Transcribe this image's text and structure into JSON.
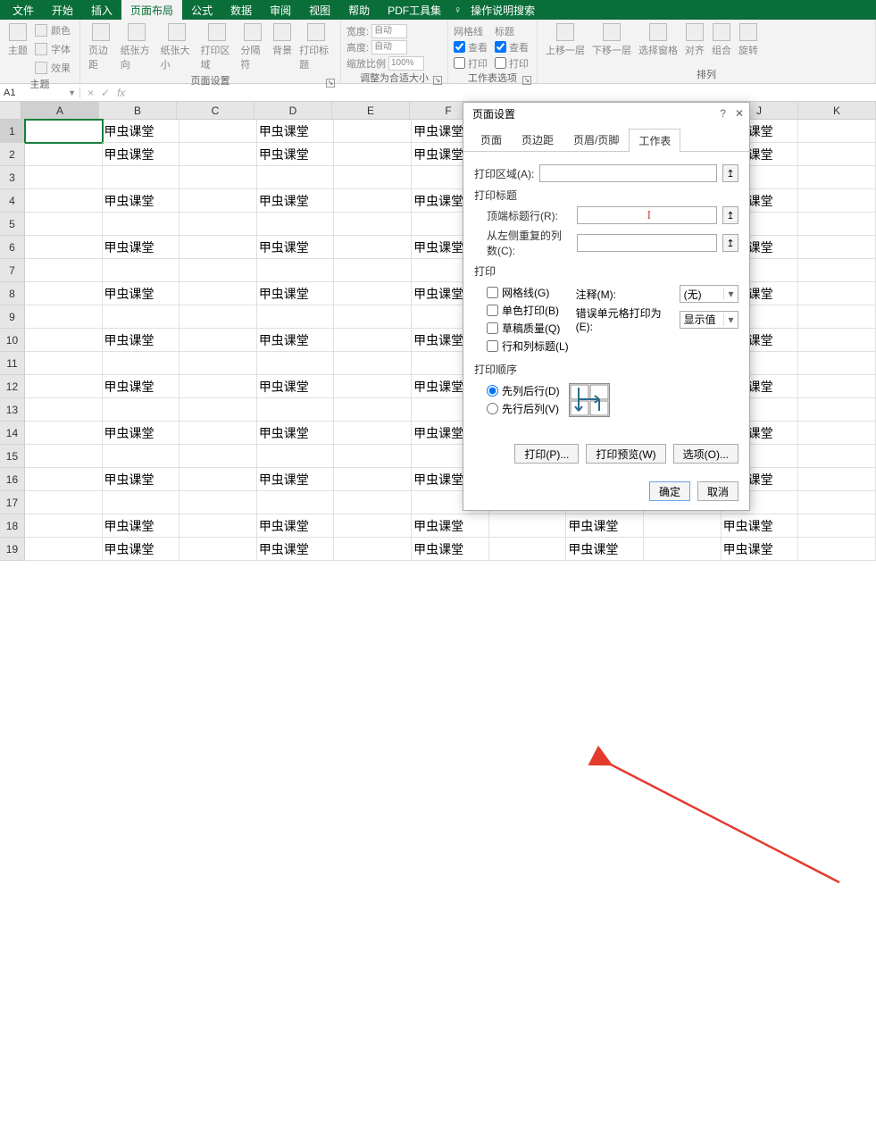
{
  "menubar": {
    "items": [
      "文件",
      "开始",
      "插入",
      "页面布局",
      "公式",
      "数据",
      "审阅",
      "视图",
      "帮助",
      "PDF工具集"
    ],
    "active_index": 3,
    "tellme": "操作说明搜索"
  },
  "ribbon": {
    "themes": {
      "btn": "主题",
      "sub1": "颜色",
      "sub2": "字体",
      "sub3": "效果",
      "label": "主题"
    },
    "page_setup": {
      "btns": [
        "页边距",
        "纸张方向",
        "纸张大小",
        "打印区域",
        "分隔符",
        "背景",
        "打印标题"
      ],
      "label": "页面设置"
    },
    "scale": {
      "width": "宽度:",
      "height": "高度:",
      "auto": "自动",
      "ratio_lbl": "缩放比例",
      "ratio_val": "100%",
      "label": "调整为合适大小"
    },
    "sheet_opts": {
      "grid": "网格线",
      "heading": "标题",
      "view": "查看",
      "print": "打印",
      "label": "工作表选项"
    },
    "arrange": {
      "btns": [
        "上移一层",
        "下移一层",
        "选择窗格",
        "对齐",
        "组合",
        "旋转"
      ],
      "label": "排列"
    }
  },
  "name_box": "A1",
  "columns": [
    "A",
    "B",
    "C",
    "D",
    "E",
    "F",
    "G",
    "H",
    "I",
    "J",
    "K"
  ],
  "row_count": 19,
  "data_text": "甲虫课堂",
  "chart_data": null,
  "dialog": {
    "title": "页面设置",
    "tabs": [
      "页面",
      "页边距",
      "页眉/页脚",
      "工作表"
    ],
    "active_tab": 3,
    "print_area_lbl": "打印区域(A):",
    "titles_lbl": "打印标题",
    "top_rows_lbl": "顶端标题行(R):",
    "left_cols_lbl": "从左侧重复的列数(C):",
    "print_section": "打印",
    "cb_grid": "网格线(G)",
    "cb_mono": "单色打印(B)",
    "cb_draft": "草稿质量(Q)",
    "cb_rowcol": "行和列标题(L)",
    "comments_lbl": "注释(M):",
    "comments_val": "(无)",
    "errors_lbl": "错误单元格打印为(E):",
    "errors_val": "显示值",
    "order_section": "打印顺序",
    "order1": "先列后行(D)",
    "order2": "先行后列(V)",
    "btn_print": "打印(P)...",
    "btn_preview": "打印预览(W)",
    "btn_options": "选项(O)...",
    "btn_ok": "确定",
    "btn_cancel": "取消"
  }
}
